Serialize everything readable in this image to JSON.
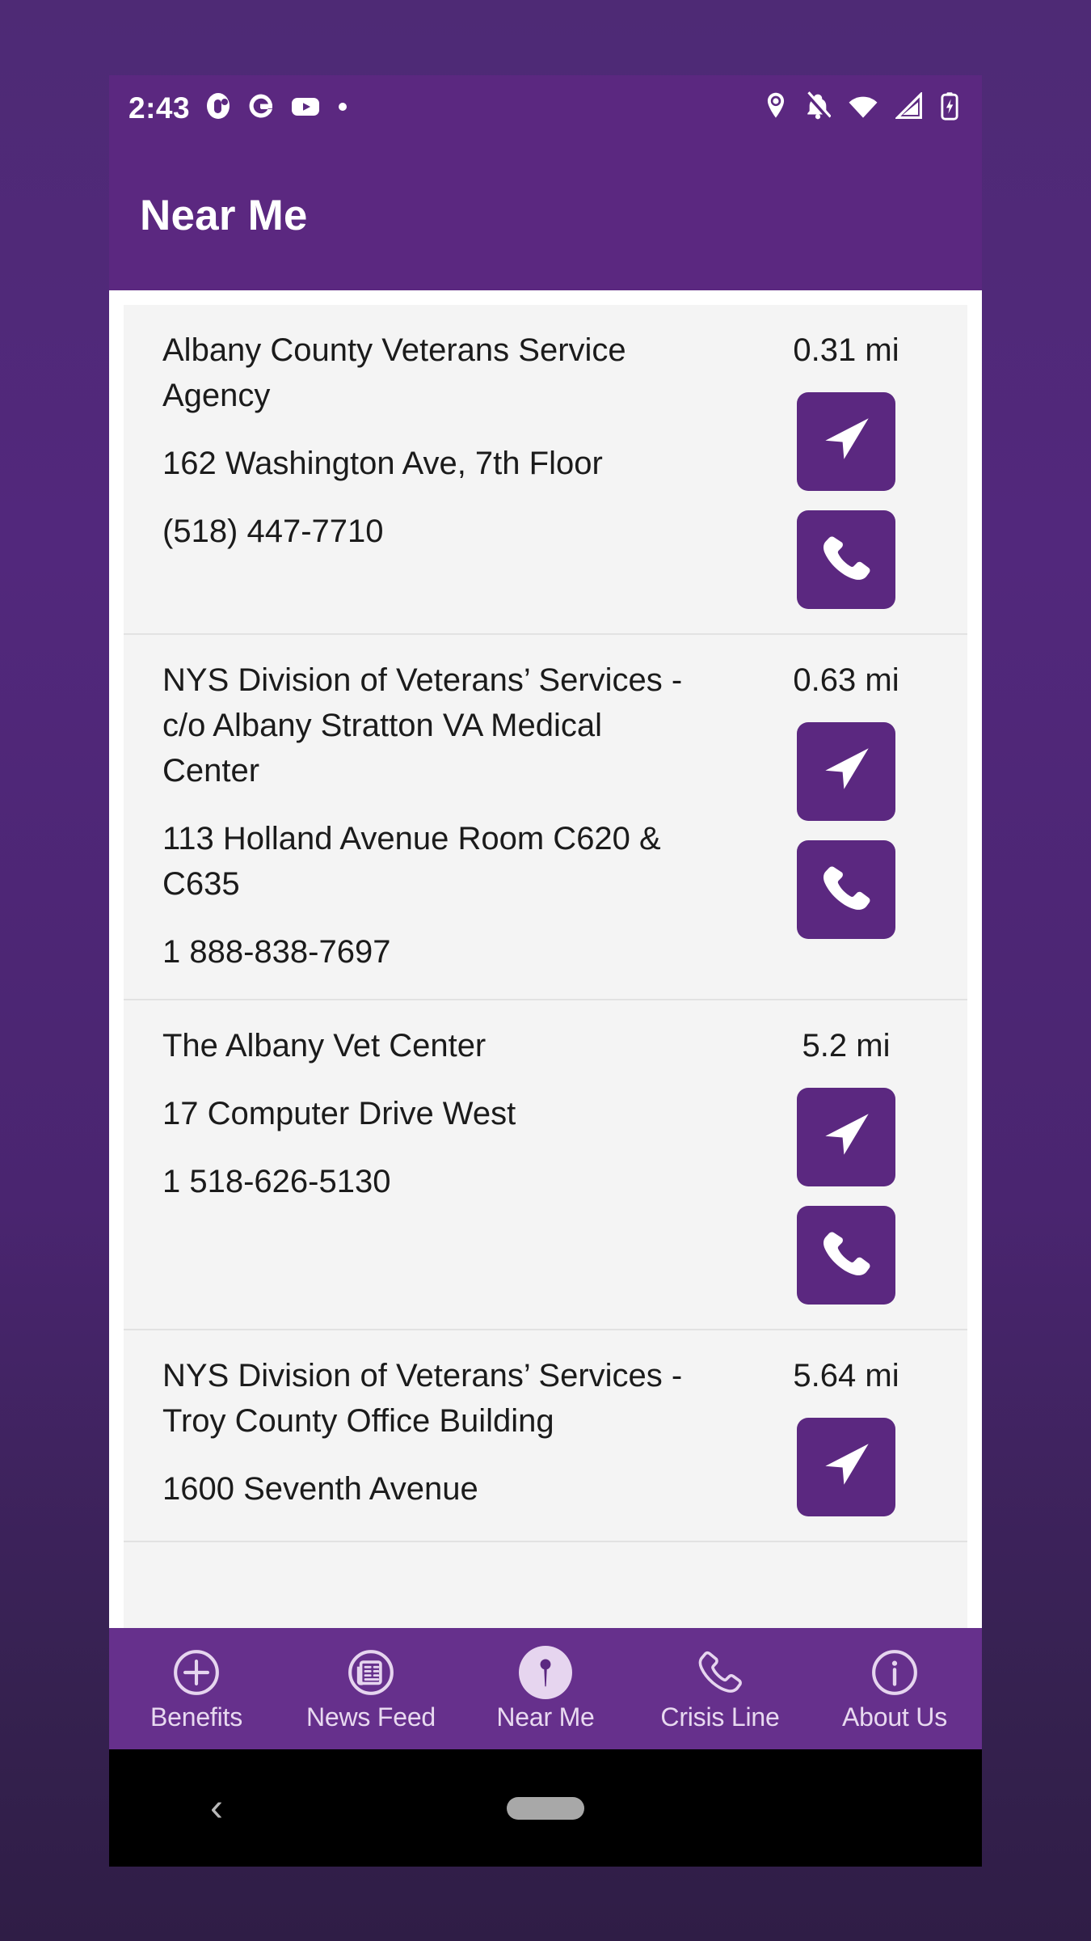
{
  "status_bar": {
    "time": "2:43",
    "notification_icons": [
      "app-badge-icon",
      "google-icon",
      "youtube-icon",
      "dot-icon"
    ],
    "system_icons": [
      "location-icon",
      "notifications-off-icon",
      "wifi-icon",
      "cell-signal-icon",
      "battery-charging-icon"
    ]
  },
  "app_bar": {
    "title": "Near Me",
    "background_color": "#5B2880"
  },
  "theme": {
    "primary_purple": "#5B2880",
    "nav_purple": "#66308C",
    "card_background": "#F4F4F4",
    "nav_label_color": "#E8D9F0"
  },
  "locations": [
    {
      "name": "Albany County Veterans Service Agency",
      "address": "162 Washington Ave, 7th Floor",
      "phone": "(518) 447-7710",
      "distance": "0.31 mi",
      "actions": [
        "directions-button",
        "call-button"
      ]
    },
    {
      "name": "NYS Division of Veterans’ Services - c/o Albany Stratton VA Medical Center",
      "address": "113 Holland Avenue Room C620 & C635",
      "phone": "1 888-838-7697",
      "distance": "0.63 mi",
      "actions": [
        "directions-button",
        "call-button"
      ]
    },
    {
      "name": "The Albany Vet Center",
      "address": "17 Computer Drive West",
      "phone": "1 518-626-5130",
      "distance": "5.2 mi",
      "actions": [
        "directions-button",
        "call-button"
      ]
    },
    {
      "name": "NYS Division of Veterans’ Services - Troy County Office Building",
      "address": "1600 Seventh Avenue",
      "phone": "",
      "distance": "5.64 mi",
      "actions": [
        "directions-button"
      ]
    }
  ],
  "bottom_nav": {
    "items": [
      {
        "label": "Benefits",
        "icon": "plus-circle-icon",
        "selected": false
      },
      {
        "label": "News Feed",
        "icon": "newspaper-circle-icon",
        "selected": false
      },
      {
        "label": "Near Me",
        "icon": "map-pin-icon",
        "selected": true
      },
      {
        "label": "Crisis Line",
        "icon": "phone-icon",
        "selected": false
      },
      {
        "label": "About Us",
        "icon": "info-circle-icon",
        "selected": false
      }
    ]
  },
  "android_nav": {
    "back": "‹",
    "home_pill": "home-pill"
  }
}
